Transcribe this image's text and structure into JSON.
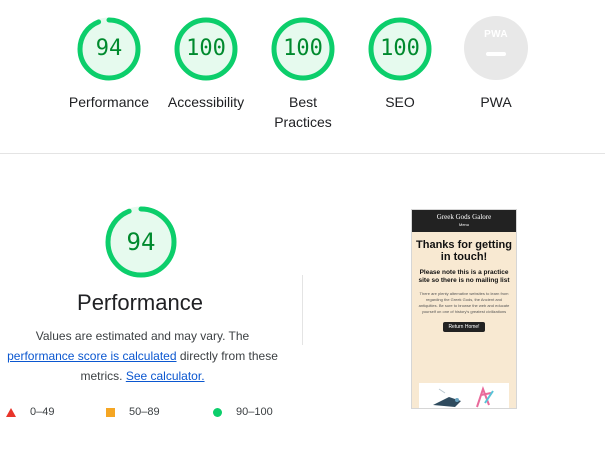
{
  "top_categories": [
    {
      "name": "Performance",
      "score": "94",
      "fraction": 0.94,
      "label_lines": [
        "Performance"
      ]
    },
    {
      "name": "Accessibility",
      "score": "100",
      "fraction": 1.0,
      "label_lines": [
        "Accessibility"
      ]
    },
    {
      "name": "Best Practices",
      "score": "100",
      "fraction": 1.0,
      "label_lines": [
        "Best",
        "Practices"
      ]
    },
    {
      "name": "SEO",
      "score": "100",
      "fraction": 1.0,
      "label_lines": [
        "SEO"
      ]
    }
  ],
  "pwa": {
    "badge_text": "PWA",
    "label": "PWA"
  },
  "performance": {
    "score": "94",
    "fraction": 0.94,
    "title": "Performance",
    "desc_part1": "Values are estimated and may vary. The",
    "link_score": "performance score is calculated",
    "desc_part2": "directly from these metrics.",
    "link_calculator": "See calculator."
  },
  "legend": [
    {
      "shape": "triangle",
      "range": "0–49",
      "color": "#e8342a"
    },
    {
      "shape": "square",
      "range": "50–89",
      "color": "#f5a623"
    },
    {
      "shape": "circle",
      "range": "90–100",
      "color": "#0cce6b"
    }
  ],
  "thumbnail": {
    "site_title": "Greek Gods Galore",
    "menu": "Menu",
    "heading": "Thanks for getting in touch!",
    "note": "Please note this is a practice site so there is no mailing list",
    "body": "There are plenty alternative websites to learn from regarding the Greek Gods, the Ancient and antiquities. Be sure to browse the web and educate yourself on one of history's greatest civilizations",
    "button": "Return Home!"
  },
  "colors": {
    "pass": "#0cce6b",
    "pass_text": "#008a2e",
    "pass_fill": "#e6faee",
    "average": "#f5a623",
    "fail": "#e8342a"
  }
}
